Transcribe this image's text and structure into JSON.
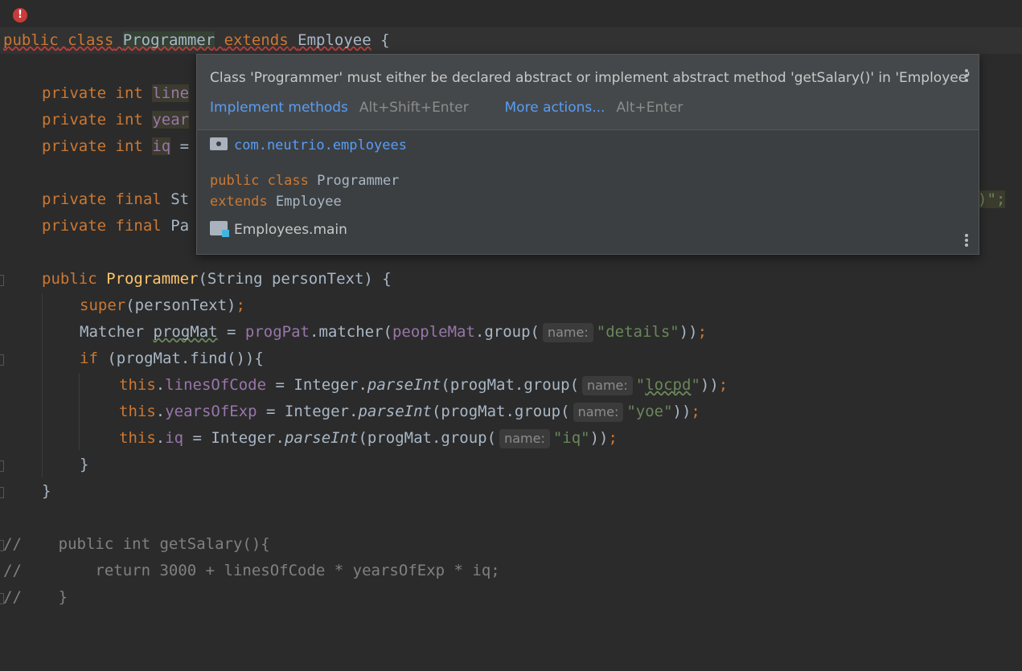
{
  "code": {
    "kw_public": "public",
    "kw_class": "class",
    "kw_extends": "extends",
    "kw_private": "private",
    "kw_int": "int",
    "kw_final": "final",
    "kw_if": "if",
    "kw_this": "this",
    "kw_super": "super",
    "class_name": "Programmer",
    "parent_class": "Employee",
    "brace_open": " {",
    "field1_partial": "line",
    "field2_partial": "year",
    "field3_name": "iq",
    "field3_rest": " =",
    "final1_type_partial": "St",
    "final2_type_partial": "Pa",
    "line_end_right": ")\";",
    "ctor_name": "Programmer",
    "ctor_params": "(String personText) {",
    "super_args": "(personText)",
    "semicolon": ";",
    "matcher_type": "Matcher ",
    "matcher_var": "progMat",
    "matcher_eq": " = ",
    "progpat": "progPat",
    "dot_matcher": ".matcher(",
    "peoplemat": "peopleMat",
    "dot_group": ".group(",
    "hint_name": "name:",
    "str_details": "\"details\"",
    "close2": "))",
    "if_cond": " (progMat.find()){",
    "dot": ".",
    "f_loc": "linesOfCode",
    "f_yoe": "yearsOfExp",
    "f_iq": "iq",
    "assign_integer": " = Integer.",
    "assign_integer_loc": " = Integer.",
    "parseint": "parseInt",
    "progmat_group": "(progMat.group(",
    "str_locpd_q1": "\"",
    "str_locpd": "locpd",
    "str_locpd_q2": "\"",
    "str_yoe": "\"yoe\"",
    "str_iq": "\"iq\"",
    "close_brace": "}",
    "comment1": "//    public int getSalary(){",
    "comment2": "//        return 3000 + linesOfCode * yearsOfExp * iq;",
    "comment3": "//    }"
  },
  "popup": {
    "message": "Class 'Programmer' must either be declared abstract or implement abstract method 'getSalary()' in 'Employee'",
    "implement_label": "Implement methods",
    "implement_shortcut": "Alt+Shift+Enter",
    "more_label": "More actions...",
    "more_shortcut": "Alt+Enter",
    "package": "com.neutrio.employees",
    "decl_line1_kw": "public class",
    "decl_line1_name": " Programmer",
    "decl_line2_kw": "extends",
    "decl_line2_name": " Employee",
    "module": "Employees.main"
  },
  "icons": [
    "error-icon",
    "package-icon",
    "module-icon",
    "more-options-icon"
  ]
}
